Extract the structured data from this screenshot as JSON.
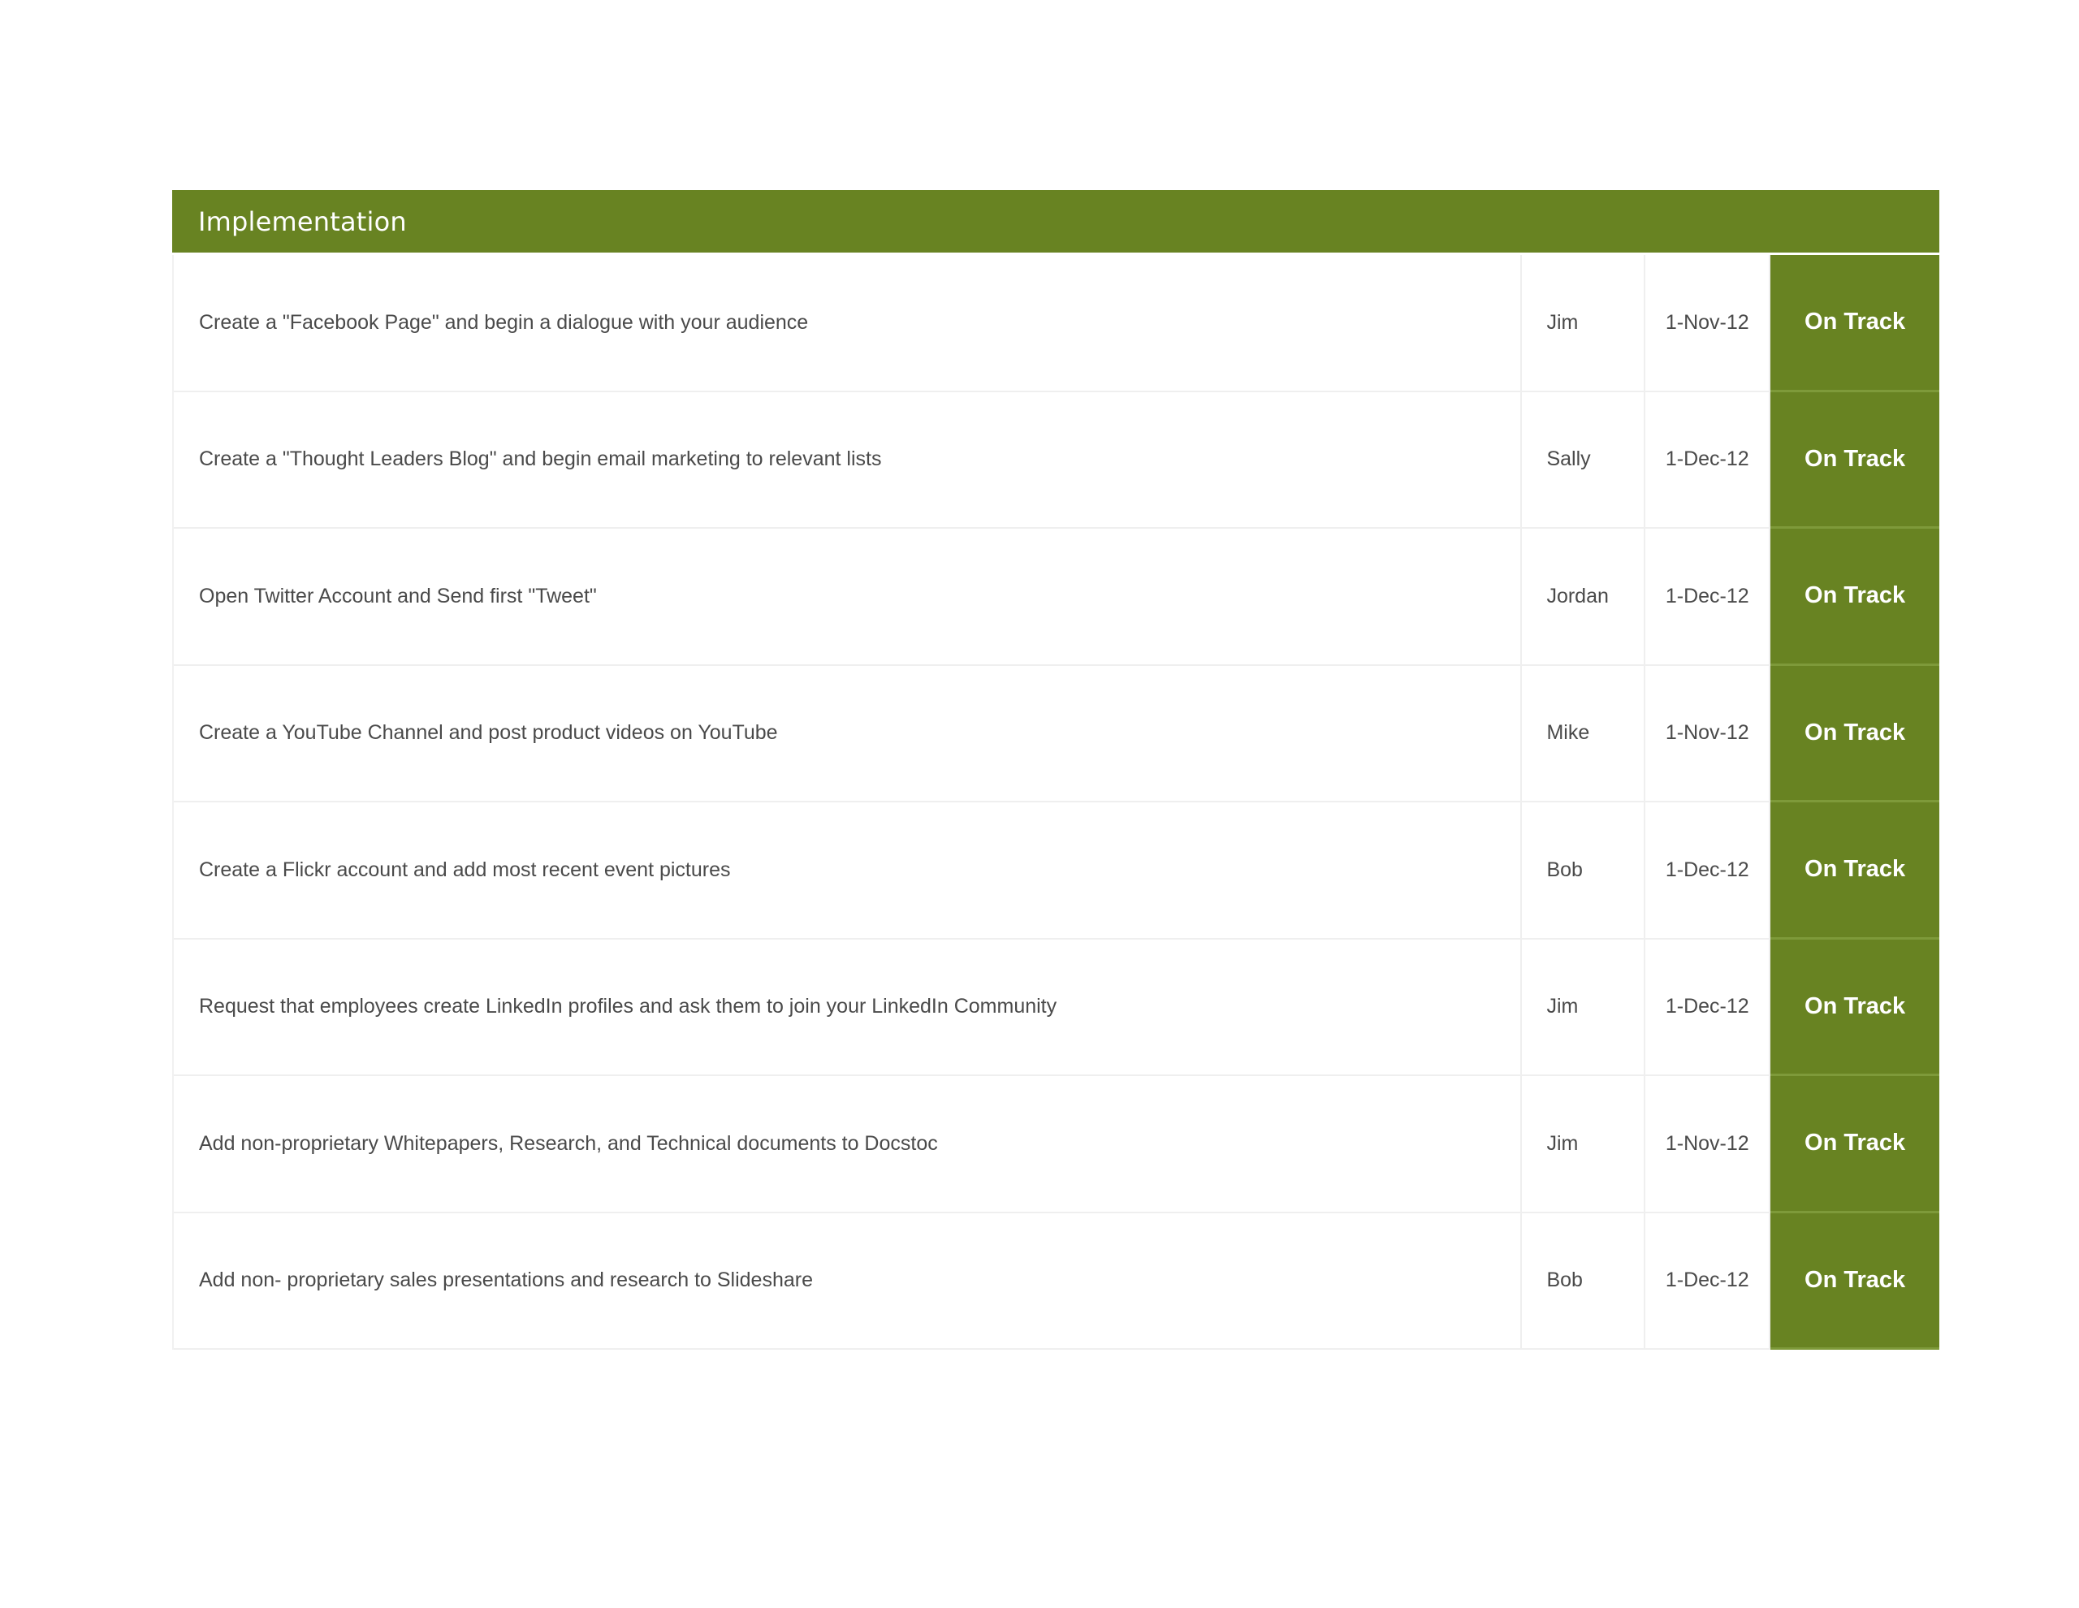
{
  "section_title": "Implementation",
  "rows": [
    {
      "task": "Create a \"Facebook Page\" and begin a dialogue with your audience",
      "owner": "Jim",
      "date": "1-Nov-12",
      "status": "On Track"
    },
    {
      "task": "Create a \"Thought Leaders Blog\" and begin email marketing to relevant lists",
      "owner": "Sally",
      "date": "1-Dec-12",
      "status": "On Track"
    },
    {
      "task": "Open Twitter Account and Send first \"Tweet\"",
      "owner": "Jordan",
      "date": "1-Dec-12",
      "status": "On Track"
    },
    {
      "task": "Create a YouTube Channel and post product videos on YouTube",
      "owner": "Mike",
      "date": "1-Nov-12",
      "status": "On Track"
    },
    {
      "task": "Create a Flickr account and add most recent event pictures",
      "owner": "Bob",
      "date": "1-Dec-12",
      "status": "On Track"
    },
    {
      "task": "Request that employees create LinkedIn profiles and ask them to join your LinkedIn Community",
      "owner": "Jim",
      "date": "1-Dec-12",
      "status": "On Track"
    },
    {
      "task": "Add non-proprietary Whitepapers, Research, and Technical documents to Docstoc",
      "owner": "Jim",
      "date": "1-Nov-12",
      "status": "On Track"
    },
    {
      "task": "Add non- proprietary sales presentations and research to Slideshare",
      "owner": "Bob",
      "date": "1-Dec-12",
      "status": "On Track"
    }
  ],
  "colors": {
    "header_bg": "#688322",
    "status_bg": "#688322",
    "text": "#4a4a4a"
  }
}
